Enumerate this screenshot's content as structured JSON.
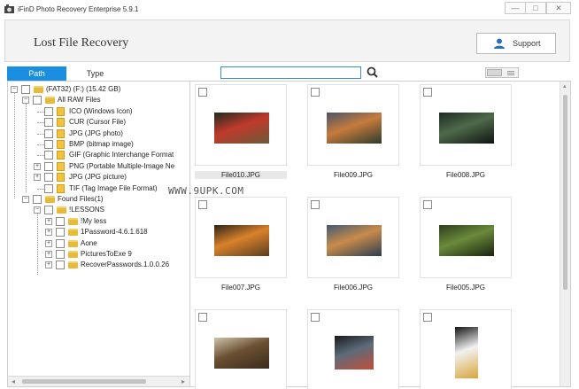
{
  "window": {
    "title": "iFinD Photo Recovery Enterprise 5.9.1",
    "min_glyph": "—",
    "max_glyph": "□",
    "close_glyph": "✕"
  },
  "header": {
    "title": "Lost File Recovery",
    "support_label": "Support"
  },
  "tabs": [
    "Path",
    "Type"
  ],
  "search": {
    "value": "",
    "placeholder": ""
  },
  "tree": [
    {
      "label": "(FAT32) (F:) (15.42 GB)",
      "icon": "folder-icon",
      "level": 0,
      "expander": "−"
    },
    {
      "label": "All RAW Files",
      "icon": "folder-icon",
      "level": 1,
      "expander": "−"
    },
    {
      "label": "ICO (Windows Icon)",
      "icon": "file-icon",
      "level": 2,
      "expander": ""
    },
    {
      "label": "CUR (Cursor File)",
      "icon": "file-icon",
      "level": 2,
      "expander": ""
    },
    {
      "label": "JPG (JPG photo)",
      "icon": "file-icon",
      "level": 2,
      "expander": ""
    },
    {
      "label": "BMP (bitmap image)",
      "icon": "file-icon",
      "level": 2,
      "expander": ""
    },
    {
      "label": "GIF (Graphic Interchange Format",
      "icon": "file-icon",
      "level": 2,
      "expander": ""
    },
    {
      "label": "PNG (Portable Multiple-Image Ne",
      "icon": "file-icon",
      "level": 2,
      "expander": "+"
    },
    {
      "label": "JPG (JPG picture)",
      "icon": "file-icon",
      "level": 2,
      "expander": "+"
    },
    {
      "label": "TIF (Tag Image File Format)",
      "icon": "file-icon",
      "level": 2,
      "expander": ""
    },
    {
      "label": "Found Files(1)",
      "icon": "folder-icon",
      "level": 1,
      "expander": "−"
    },
    {
      "label": "!LESSONS",
      "icon": "folder-icon",
      "level": 2,
      "expander": "−"
    },
    {
      "label": "!My less",
      "icon": "folder-icon",
      "level": 3,
      "expander": "+"
    },
    {
      "label": "1Password-4.6.1.618",
      "icon": "folder-icon",
      "level": 3,
      "expander": "+"
    },
    {
      "label": "Aone",
      "icon": "folder-icon",
      "level": 3,
      "expander": "+"
    },
    {
      "label": "PicturesToExe 9",
      "icon": "folder-icon",
      "level": 3,
      "expander": "+"
    },
    {
      "label": "RecoverPasswords.1.0.0.26",
      "icon": "folder-icon",
      "level": 3,
      "expander": "+"
    }
  ],
  "watermark": "WWW.9UPK.COM",
  "thumbnails": [
    {
      "name": "File010.JPG",
      "selected": true,
      "subject": "bird on branch",
      "colors": [
        "#1d2b1f",
        "#c0392b",
        "#6b5a3a"
      ]
    },
    {
      "name": "File009.JPG",
      "selected": false,
      "subject": "house by lake",
      "colors": [
        "#4a5468",
        "#c77b3c",
        "#2c3b2e"
      ]
    },
    {
      "name": "File008.JPG",
      "selected": false,
      "subject": "dark landscape",
      "colors": [
        "#1e2a22",
        "#4e6a4a",
        "#0f1512"
      ]
    },
    {
      "name": "File007.JPG",
      "selected": false,
      "subject": "sunset coast",
      "colors": [
        "#2b2318",
        "#d9822b",
        "#5a3d20"
      ]
    },
    {
      "name": "File006.JPG",
      "selected": false,
      "subject": "mountain lake",
      "colors": [
        "#405a72",
        "#c98b4a",
        "#2c3e50"
      ]
    },
    {
      "name": "File005.JPG",
      "selected": false,
      "subject": "forest stream",
      "colors": [
        "#2e3d1e",
        "#6b8a3a",
        "#1a2410"
      ]
    },
    {
      "name": "",
      "selected": false,
      "subject": "lemurs",
      "colors": [
        "#cfc3a8",
        "#6b5033",
        "#3a2b1a"
      ]
    },
    {
      "name": "",
      "selected": false,
      "subject": "vulture",
      "colors": [
        "#1a1a1a",
        "#5c6b7a",
        "#c44e3a"
      ]
    },
    {
      "name": "",
      "selected": false,
      "subject": "heron",
      "colors": [
        "#141414",
        "#f2f2f2",
        "#d9a53a"
      ]
    }
  ]
}
